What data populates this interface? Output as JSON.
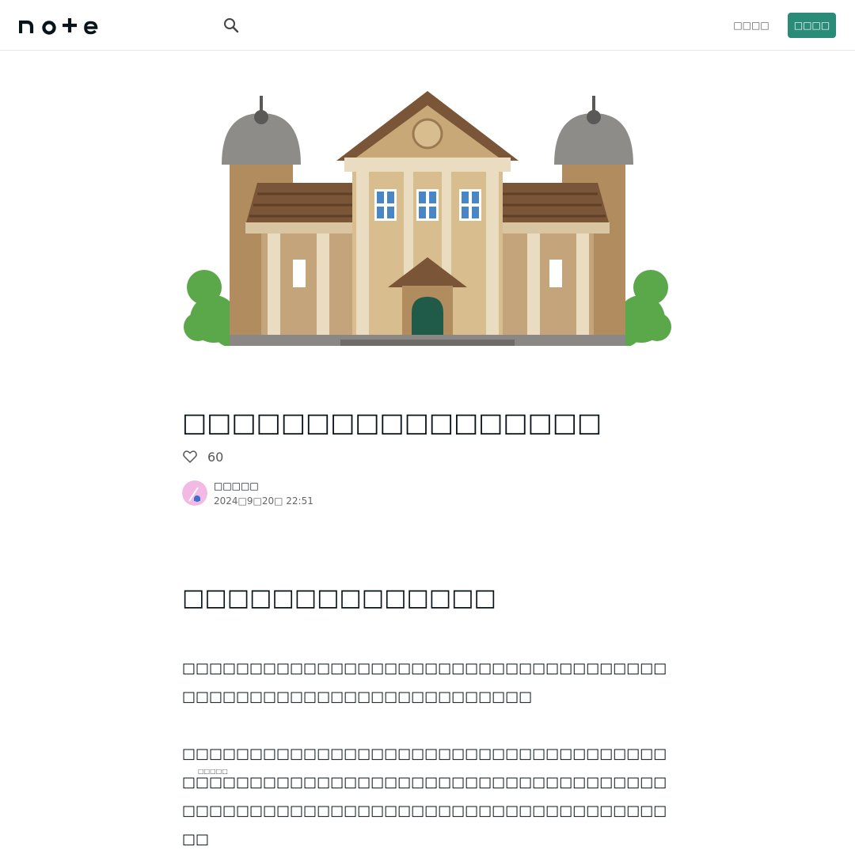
{
  "header": {
    "logo_text": "note",
    "login_label": "□□□□",
    "signup_label": "□□□□"
  },
  "hero": {
    "description": "illustration of a brick museum building"
  },
  "article": {
    "title": "□□□□□□□□□□□□□□□□□",
    "like_count": "60",
    "author": {
      "name": "□□□□□",
      "date": "2024□9□20□ 22:51"
    },
    "heading": "□□□□□□□□□□□□□□",
    "paragraphs": [
      "□□□□□□□□□□□□□□□□□□□□□□□□□□□□□□□□□□□□□□□□□□□□□□□□□□□□□□□□□□□□□□",
      "□□□□□□□□□□□□□□□□□□□□□□□□□□□□□□□□□□□□□□□□□□□□□□□□□□□□□□□□□□□□□□□□□□□□□□□□□□□□□□□□□□□□□□□□□□□□□□□□□□□□□□□□□□□□□□"
    ],
    "ruby_note": "□□□□□"
  },
  "colors": {
    "accent": "#2a8b78",
    "text": "#08131a"
  },
  "icons": {
    "search": "search-icon",
    "like": "heart-outline-icon"
  }
}
